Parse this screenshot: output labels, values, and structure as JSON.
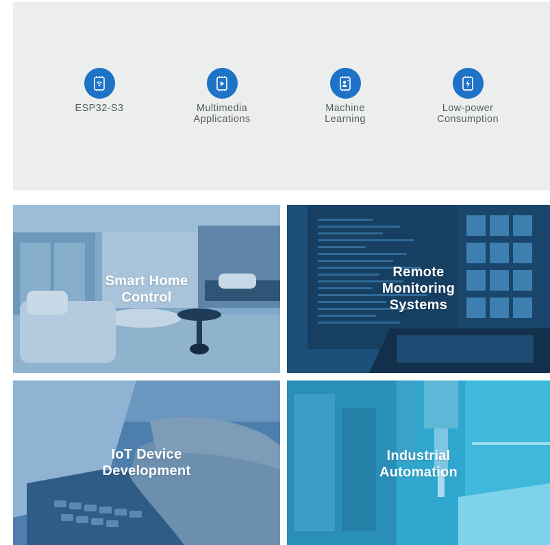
{
  "features": [
    {
      "label": "ESP32-S3",
      "icon": "chip-wifi-icon"
    },
    {
      "label": "Multimedia\nApplications",
      "icon": "chip-play-icon"
    },
    {
      "label": "Machine\nLearning",
      "icon": "chip-person-icon"
    },
    {
      "label": "Low-power\nConsumption",
      "icon": "chip-battery-icon"
    }
  ],
  "tiles": [
    {
      "title": "Smart Home\nControl"
    },
    {
      "title": "Remote\nMonitoring\nSystems"
    },
    {
      "title": "IoT Device\nDevelopment"
    },
    {
      "title": "Industrial\nAutomation"
    }
  ],
  "colors": {
    "accent": "#1e73c6",
    "panel_bg": "#eceeee",
    "feature_text": "#555a5e",
    "overlay_blue": "#1f6fb5"
  }
}
